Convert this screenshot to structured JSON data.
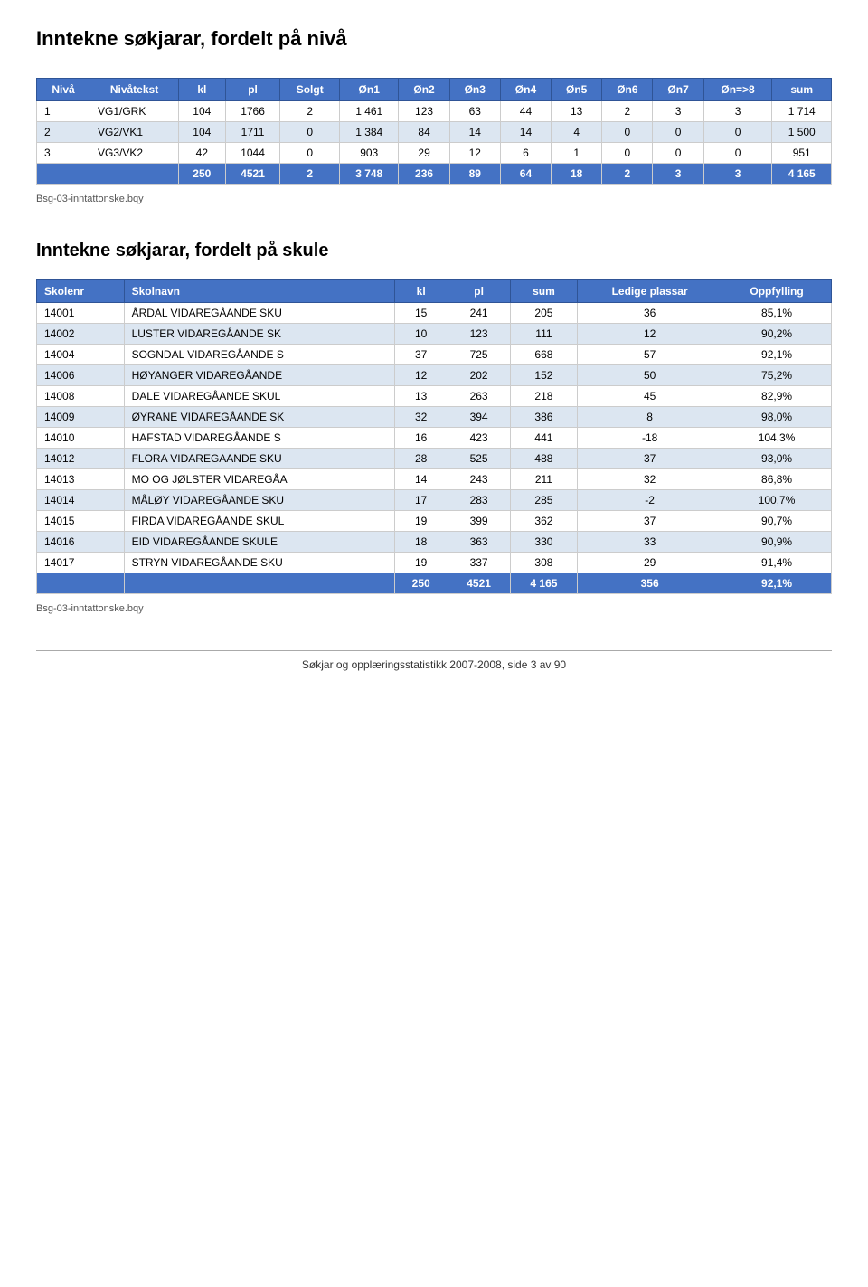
{
  "page": {
    "title1": "Inntekne søkjarar, fordelt på nivå",
    "title2": "Inntekne søkjarar, fordelt på skule",
    "filename": "Bsg-03-inntattonske.bqy",
    "footer": "Søkjar og opplæringsstatistikk 2007-2008, side 3 av 90"
  },
  "niva_table": {
    "headers": [
      "Nivå",
      "Nivåtekst",
      "kl",
      "pl",
      "Solgt",
      "Øn1",
      "Øn2",
      "Øn3",
      "Øn4",
      "Øn5",
      "Øn6",
      "Øn7",
      "Øn=>8",
      "sum"
    ],
    "rows": [
      [
        "1",
        "VG1/GRK",
        "104",
        "1766",
        "2",
        "1 461",
        "123",
        "63",
        "44",
        "13",
        "2",
        "3",
        "3",
        "1 714"
      ],
      [
        "2",
        "VG2/VK1",
        "104",
        "1711",
        "0",
        "1 384",
        "84",
        "14",
        "14",
        "4",
        "0",
        "0",
        "0",
        "1 500"
      ],
      [
        "3",
        "VG3/VK2",
        "42",
        "1044",
        "0",
        "903",
        "29",
        "12",
        "6",
        "1",
        "0",
        "0",
        "0",
        "951"
      ]
    ],
    "total_row": [
      "",
      "",
      "250",
      "4521",
      "2",
      "3 748",
      "236",
      "89",
      "64",
      "18",
      "2",
      "3",
      "3",
      "4 165"
    ]
  },
  "skule_table": {
    "headers": [
      "Skolenr",
      "Skolnavn",
      "kl",
      "pl",
      "sum",
      "Ledige plassar",
      "Oppfylling"
    ],
    "rows": [
      [
        "14001",
        "ÅRDAL VIDAREGÅANDE SKU",
        "15",
        "241",
        "205",
        "36",
        "85,1%"
      ],
      [
        "14002",
        "LUSTER VIDAREGÅANDE SK",
        "10",
        "123",
        "111",
        "12",
        "90,2%"
      ],
      [
        "14004",
        "SOGNDAL VIDAREGÅANDE S",
        "37",
        "725",
        "668",
        "57",
        "92,1%"
      ],
      [
        "14006",
        "HØYANGER VIDAREGÅANDE",
        "12",
        "202",
        "152",
        "50",
        "75,2%"
      ],
      [
        "14008",
        "DALE VIDAREGÅANDE SKUL",
        "13",
        "263",
        "218",
        "45",
        "82,9%"
      ],
      [
        "14009",
        "ØYRANE VIDAREGÅANDE SK",
        "32",
        "394",
        "386",
        "8",
        "98,0%"
      ],
      [
        "14010",
        "HAFSTAD VIDAREGÅANDE S",
        "16",
        "423",
        "441",
        "-18",
        "104,3%"
      ],
      [
        "14012",
        "FLORA VIDAREGAANDE SKU",
        "28",
        "525",
        "488",
        "37",
        "93,0%"
      ],
      [
        "14013",
        "MO OG JØLSTER VIDAREGÅA",
        "14",
        "243",
        "211",
        "32",
        "86,8%"
      ],
      [
        "14014",
        "MÅLØY VIDAREGÅANDE SKU",
        "17",
        "283",
        "285",
        "-2",
        "100,7%"
      ],
      [
        "14015",
        "FIRDA VIDAREGÅANDE SKUL",
        "19",
        "399",
        "362",
        "37",
        "90,7%"
      ],
      [
        "14016",
        "EID VIDAREGÅANDE SKULE",
        "18",
        "363",
        "330",
        "33",
        "90,9%"
      ],
      [
        "14017",
        "STRYN VIDAREGÅANDE SKU",
        "19",
        "337",
        "308",
        "29",
        "91,4%"
      ]
    ],
    "total_row": [
      "",
      "",
      "250",
      "4521",
      "4 165",
      "356",
      "92,1%"
    ]
  }
}
